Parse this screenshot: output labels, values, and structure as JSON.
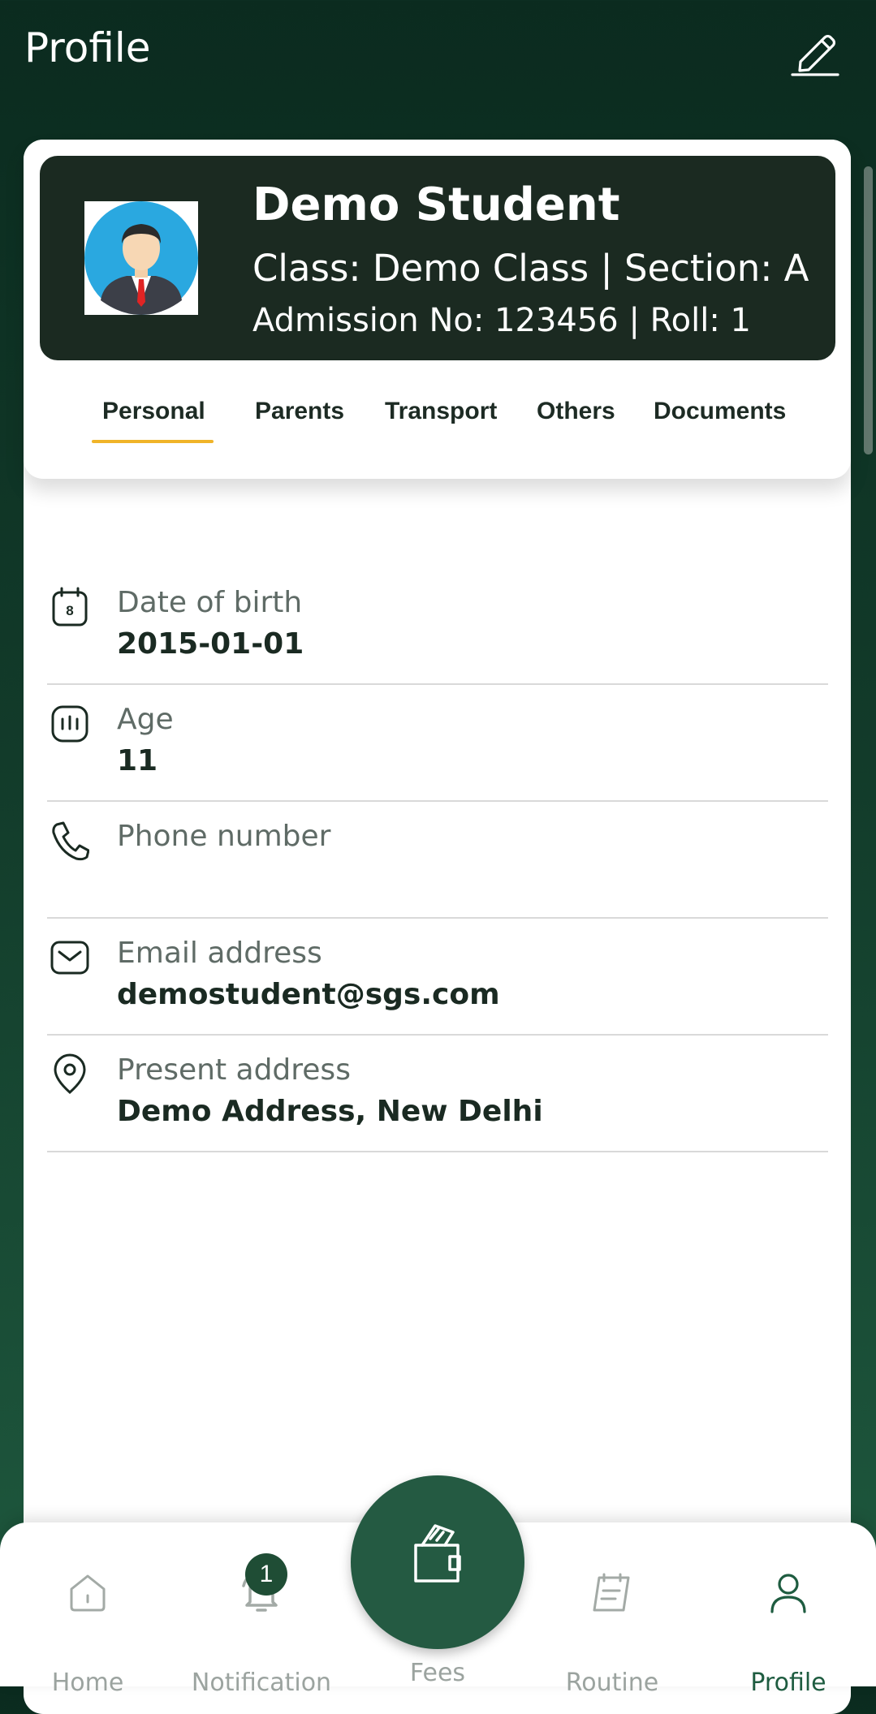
{
  "header": {
    "title": "Profile",
    "edit_icon": "pencil-icon"
  },
  "profile": {
    "name": "Demo Student",
    "class_line": "Class: Demo Class  |  Section: A",
    "admission_line": "Admission No: 123456  |  Roll: 1",
    "avatar_icon": "student-avatar"
  },
  "tabs": [
    {
      "label": "Personal",
      "active": true
    },
    {
      "label": "Parents"
    },
    {
      "label": "Transport"
    },
    {
      "label": "Others"
    },
    {
      "label": "Documents"
    }
  ],
  "info": [
    {
      "label": "Date of birth",
      "value": "2015-01-01",
      "icon": "calendar-icon"
    },
    {
      "label": "Age",
      "value": "11",
      "icon": "age-icon"
    },
    {
      "label": "Phone number",
      "value": "",
      "icon": "phone-icon"
    },
    {
      "label": "Email address",
      "value": "demostudent@sgs.com",
      "icon": "mail-icon"
    },
    {
      "label": "Present address",
      "value": "Demo Address, New Delhi",
      "icon": "location-icon"
    }
  ],
  "calendar_day": "8",
  "nav": {
    "items": [
      {
        "label": "Home",
        "icon": "home-icon"
      },
      {
        "label": "Notification",
        "icon": "bell-icon",
        "badge": "1"
      },
      {
        "label": "Fees",
        "icon": "wallet-icon"
      },
      {
        "label": "Routine",
        "icon": "routine-icon"
      },
      {
        "label": "Profile",
        "icon": "user-icon",
        "active": true
      }
    ]
  },
  "colors": {
    "accent": "#f0b429",
    "brand_dark": "#1b2a21",
    "brand_green": "#245a42"
  }
}
